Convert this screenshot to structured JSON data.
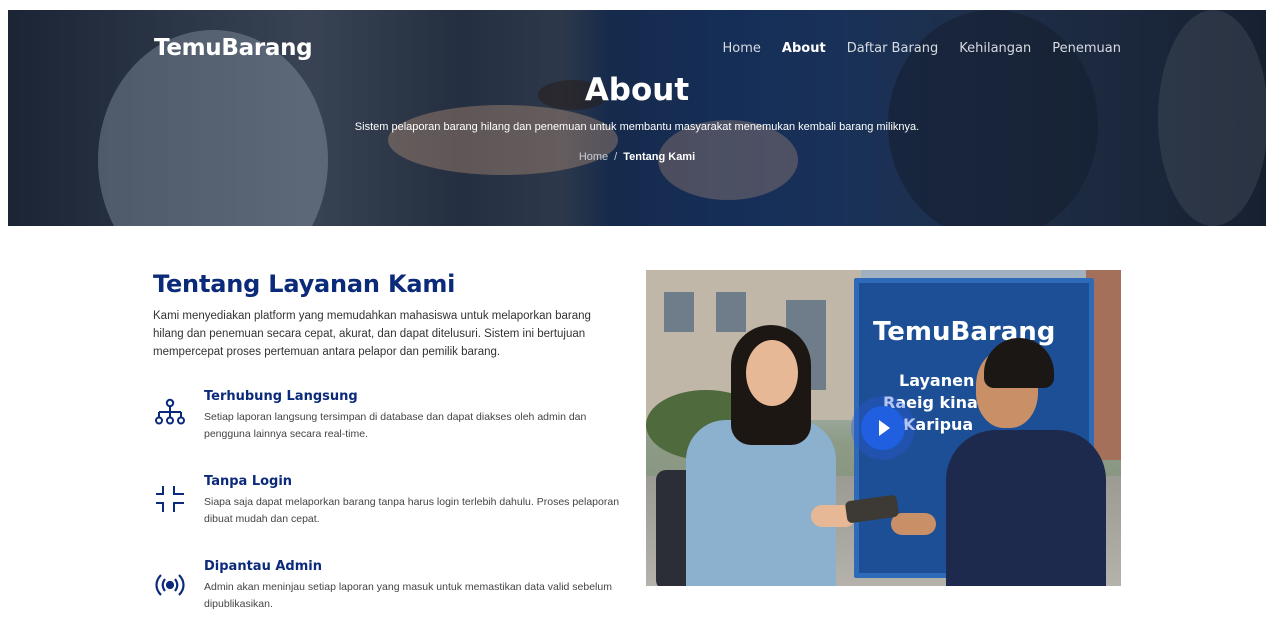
{
  "header": {
    "brand": "TemuBarang",
    "nav": [
      "Home",
      "About",
      "Daftar Barang",
      "Kehilangan",
      "Penemuan"
    ],
    "active_nav": "About"
  },
  "hero": {
    "title": "About",
    "subtitle": "Sistem pelaporan barang hilang dan penemuan untuk membantu masyarakat menemukan kembali barang miliknya.",
    "breadcrumb": {
      "home": "Home",
      "separator": "/",
      "current": "Tentang Kami"
    }
  },
  "about": {
    "title": "Tentang Layanan Kami",
    "description": "Kami menyediakan platform yang memudahkan mahasiswa untuk melaporkan barang hilang dan penemuan secara cepat, akurat, dan dapat ditelusuri. Sistem ini bertujuan mempercepat proses pertemuan antara pelapor dan pemilik barang.",
    "features": [
      {
        "icon": "network-icon",
        "title": "Terhubung Langsung",
        "text": "Setiap laporan langsung tersimpan di database dan dapat diakses oleh admin dan pengguna lainnya secara real-time."
      },
      {
        "icon": "scan-corners-icon",
        "title": "Tanpa Login",
        "text": "Siapa saja dapat melaporkan barang tanpa harus login terlebih dahulu. Proses pelaporan dibuat mudah dan cepat."
      },
      {
        "icon": "broadcast-icon",
        "title": "Dipantau Admin",
        "text": "Admin akan meninjau setiap laporan yang masuk untuk memastikan data valid sebelum dipublikasikan."
      }
    ]
  },
  "video": {
    "sign_title": "TemuBarang",
    "sign_lines": [
      "Layanen",
      "Raeig kina",
      "Karipua"
    ]
  },
  "colors": {
    "accent": "#0b2a7a",
    "play": "#1f5fe0"
  }
}
